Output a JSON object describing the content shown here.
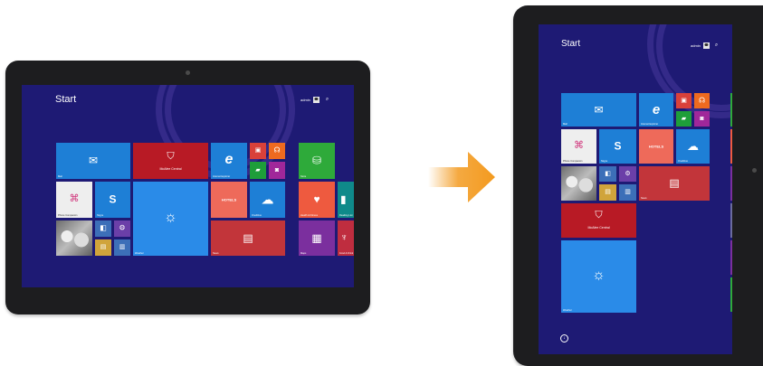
{
  "colors": {
    "screen_bg": "#1e1a74",
    "mail": "#1e7fd6",
    "mcafee": "#b81a25",
    "ie": "#1e7fd6",
    "video": "#d9413a",
    "music": "#ee6a1f",
    "games": "#1e9e3a",
    "camera": "#a0279a",
    "store": "#2eaa3a",
    "skype": "#1e7fd6",
    "weather": "#2a8be8",
    "onedrive": "#1e7fd6",
    "news": "#c2353a",
    "health": "#ee5a3f",
    "reading": "#0f8a8a",
    "maps": "#7b2f9e",
    "food": "#bf2d3f",
    "pc_companion": "#eeeeee",
    "desktop": "#3c6fb8",
    "settings": "#6b3fa8",
    "people": "#eb8a1f",
    "explorer": "#d0a43b",
    "arrow": "#f39a1f"
  },
  "icons": {
    "mail": "envelope-icon",
    "mcafee": "shield-icon",
    "ie": "internet-explorer-icon",
    "video": "video-icon",
    "music": "headphones-icon",
    "games": "gamepad-icon",
    "camera": "camera-icon",
    "store": "shopping-bag-icon",
    "skype": "skype-icon",
    "weather": "sun-icon",
    "onedrive": "cloud-icon",
    "news": "newspaper-icon",
    "health": "heartbeat-icon",
    "maps": "map-icon",
    "food": "fork-knife-icon",
    "search": "search-icon",
    "all_apps": "down-arrow-icon",
    "transition": "right-arrow-icon"
  },
  "landscape": {
    "start_title": "Start",
    "user_name": "admin",
    "tiles": {
      "mail": "Mail",
      "mcafee": "McAfee Central",
      "ie": "Internet Explorer",
      "store": "Store",
      "pc_companion": "Phone Companion",
      "skype": "Skype",
      "onedrive": "OneDrive",
      "health": "Health & Fitness",
      "reading": "Reading List",
      "weather": "Weather",
      "news": "News",
      "maps": "Maps",
      "food": "Food & Drink",
      "hotel": "HOTELS"
    }
  },
  "portrait": {
    "start_title": "Start",
    "user_name": "admin",
    "tiles": {
      "mail": "Mail",
      "ie": "Internet Explorer",
      "pc_companion": "Phone Companion",
      "skype": "Skype",
      "onedrive": "OneDrive",
      "news": "News",
      "mcafee": "McAfee Central",
      "weather": "Weather",
      "hotel": "HOTELS"
    }
  }
}
